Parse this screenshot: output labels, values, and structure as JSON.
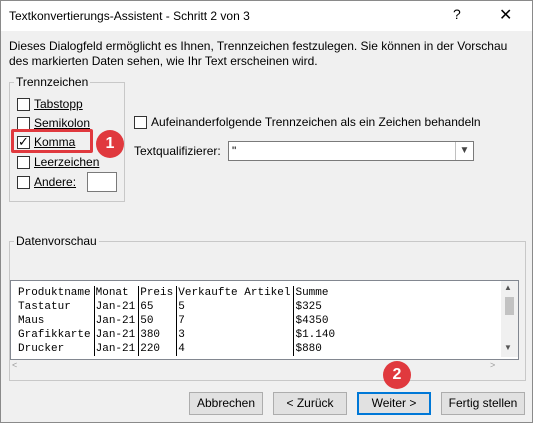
{
  "window": {
    "title": "Textkonvertierungs-Assistent - Schritt 2 von 3",
    "help": "?",
    "close": "✕"
  },
  "description": "Dieses Dialogfeld ermöglicht es Ihnen, Trennzeichen festzulegen. Sie können in der Vorschau des markierten Daten sehen, wie Ihr Text erscheinen wird.",
  "delimiters": {
    "legend": "Trennzeichen",
    "tab": {
      "label": "Tabstopp",
      "checked": false
    },
    "semicolon": {
      "label": "Semikolon",
      "checked": false
    },
    "comma": {
      "label": "Komma",
      "checked": true
    },
    "space": {
      "label": "Leerzeichen",
      "checked": false
    },
    "other": {
      "label": "Andere:",
      "checked": false,
      "value": ""
    }
  },
  "consecutive": {
    "label": "Aufeinanderfolgende Trennzeichen als ein Zeichen behandeln",
    "checked": false
  },
  "qualifier": {
    "label": "Textqualifizierer:",
    "value": "\""
  },
  "preview": {
    "legend": "Datenvorschau",
    "columns": [
      "Produktname",
      "Monat",
      "Preis",
      "Verkaufte Artikel",
      "Summe"
    ],
    "rows": [
      [
        "Tastatur",
        "Jan-21",
        "65",
        "5",
        "$325"
      ],
      [
        "Maus",
        "Jan-21",
        "50",
        "7",
        "$4350"
      ],
      [
        "Grafikkarte",
        "Jan-21",
        "380",
        "3",
        "$1.140"
      ],
      [
        "Drucker",
        "Jan-21",
        "220",
        "4",
        "$880"
      ]
    ]
  },
  "badges": {
    "one": "1",
    "two": "2"
  },
  "buttons": {
    "cancel": "Abbrechen",
    "back": "< Zurück",
    "next": "Weiter >",
    "finish": "Fertig stellen"
  },
  "colors": {
    "highlight": "#e0393e",
    "focus": "#0078d7"
  }
}
